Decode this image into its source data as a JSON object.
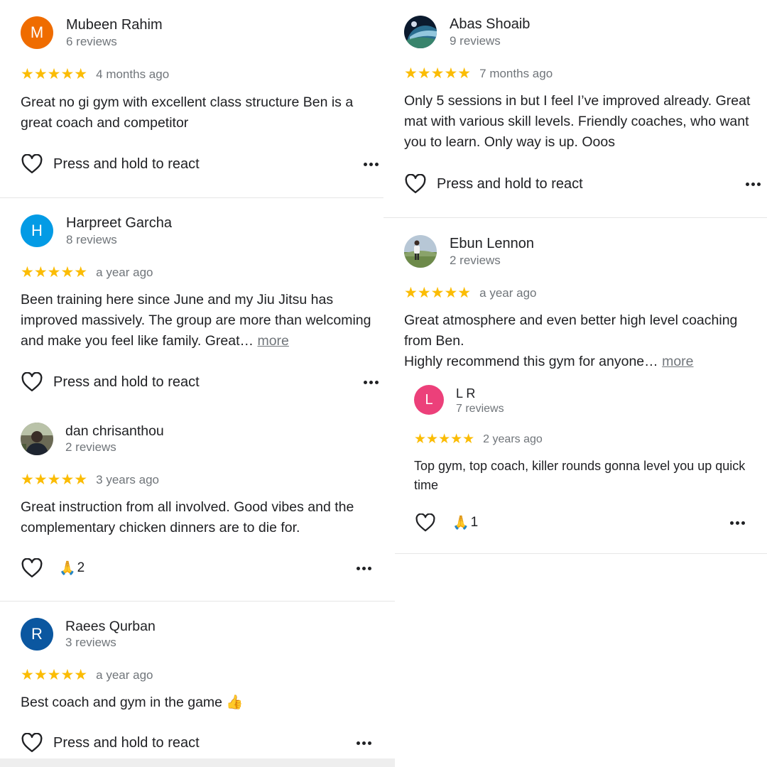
{
  "react_label": "Press and hold to react",
  "more_label": "more",
  "reviews": [
    {
      "name": "Mubeen Rahim",
      "count": "6 reviews",
      "initial": "M",
      "avatar_color": "#ef6c00",
      "stars": "★★★★★",
      "time": "4 months ago",
      "text": "Great no gi gym with excellent class structure Ben is a great coach and competitor"
    },
    {
      "name": "Harpreet Garcha",
      "count": "8 reviews",
      "initial": "H",
      "avatar_color": "#039be5",
      "stars": "★★★★★",
      "time": "a year ago",
      "text": "Been training here since June and my Jiu Jitsu has improved massively. The group are more than welcoming and make you feel like family. Great… "
    },
    {
      "name": "dan chrisanthou",
      "count": "2 reviews",
      "avatar_icon": "user-photo",
      "stars": "★★★★★",
      "time": "3 years ago",
      "text": "Great instruction from all involved. Good vibes and the complementary chicken dinners are to die for.",
      "reaction_emoji": "🙏",
      "reaction_count": "2"
    },
    {
      "name": "Raees Qurban",
      "count": "3 reviews",
      "initial": "R",
      "avatar_color": "#0b57a0",
      "stars": "★★★★★",
      "time": "a year ago",
      "text": "Best coach and gym in the game 👍"
    },
    {
      "name": "Abas Shoaib",
      "count": "9 reviews",
      "avatar_icon": "earth-photo",
      "stars": "★★★★★",
      "time": "7 months ago",
      "text": "Only 5 sessions in but I feel I’ve improved already. Great mat with various skill levels. Friendly coaches, who want you to learn. Only way is up. Ooos"
    },
    {
      "name": "Ebun Lennon",
      "count": "2 reviews",
      "avatar_icon": "landscape-photo",
      "stars": "★★★★★",
      "time": "a year ago",
      "text_line1": "Great atmosphere and even better high level coaching from Ben.",
      "text_line2": "Highly recommend this gym for anyone… "
    },
    {
      "name": "L R",
      "count": "7 reviews",
      "initial": "L",
      "avatar_color": "#ec407a",
      "stars": "★★★★★",
      "time": "2 years ago",
      "text": "Top gym, top coach, killer rounds gonna level you up quick time",
      "reaction_emoji": "🙏",
      "reaction_count": "1"
    }
  ]
}
